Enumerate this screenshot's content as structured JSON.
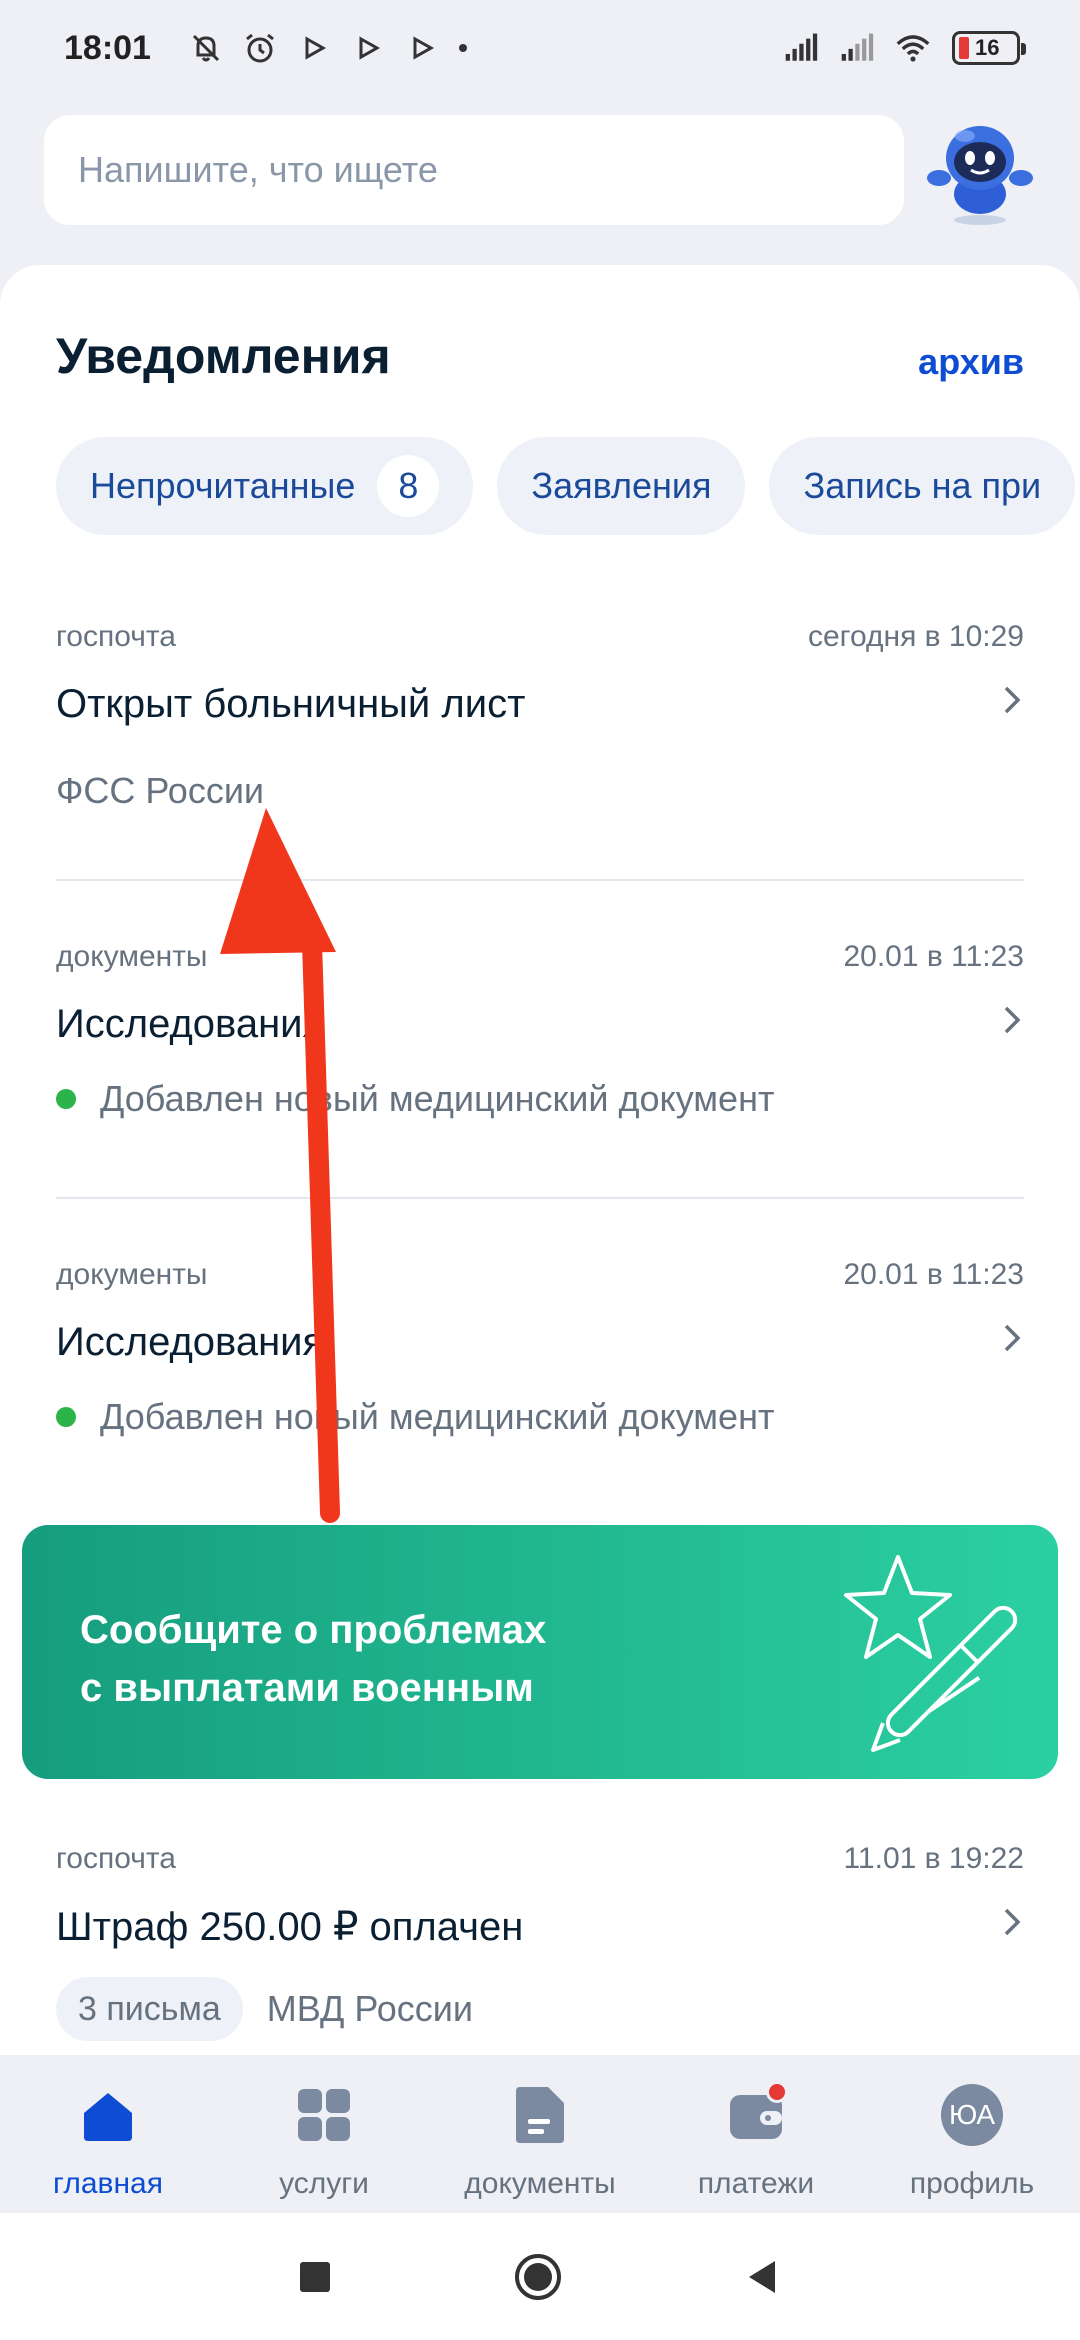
{
  "status_bar": {
    "time": "18:01",
    "battery": "16"
  },
  "search": {
    "placeholder": "Напишите, что ищете"
  },
  "header": {
    "title": "Уведомления",
    "archive": "архив"
  },
  "chips": [
    {
      "label": "Непрочитанные",
      "count": "8"
    },
    {
      "label": "Заявления"
    },
    {
      "label": "Запись на при"
    }
  ],
  "notifications": [
    {
      "category": "госпочта",
      "date": "сегодня в 10:29",
      "title": "Открыт больничный лист",
      "subtitle": "ФСС России"
    },
    {
      "category": "документы",
      "date": "20.01 в 11:23",
      "title": "Исследования",
      "subtitle": "Добавлен новый медицинский документ"
    },
    {
      "category": "документы",
      "date": "20.01 в 11:23",
      "title": "Исследования",
      "subtitle": "Добавлен новый медицинский документ"
    },
    {
      "category": "госпочта",
      "date": "11.01 в 19:22",
      "title": "Штраф 250.00 ₽ оплачен",
      "pill": "3 письма",
      "subtitle": "МВД России"
    }
  ],
  "banner": {
    "line1": "Сообщите о проблемах",
    "line2": "с выплатами военным"
  },
  "nav": [
    {
      "label": "главная"
    },
    {
      "label": "услуги"
    },
    {
      "label": "документы"
    },
    {
      "label": "платежи"
    },
    {
      "label": "профиль",
      "avatar": "ЮА"
    }
  ],
  "colors": {
    "accent": "#0d4cd3",
    "banner_start": "#169d7e",
    "banner_end": "#2bd0a2",
    "annotation_arrow": "#f0361b",
    "status_dot": "#2cb34a"
  }
}
